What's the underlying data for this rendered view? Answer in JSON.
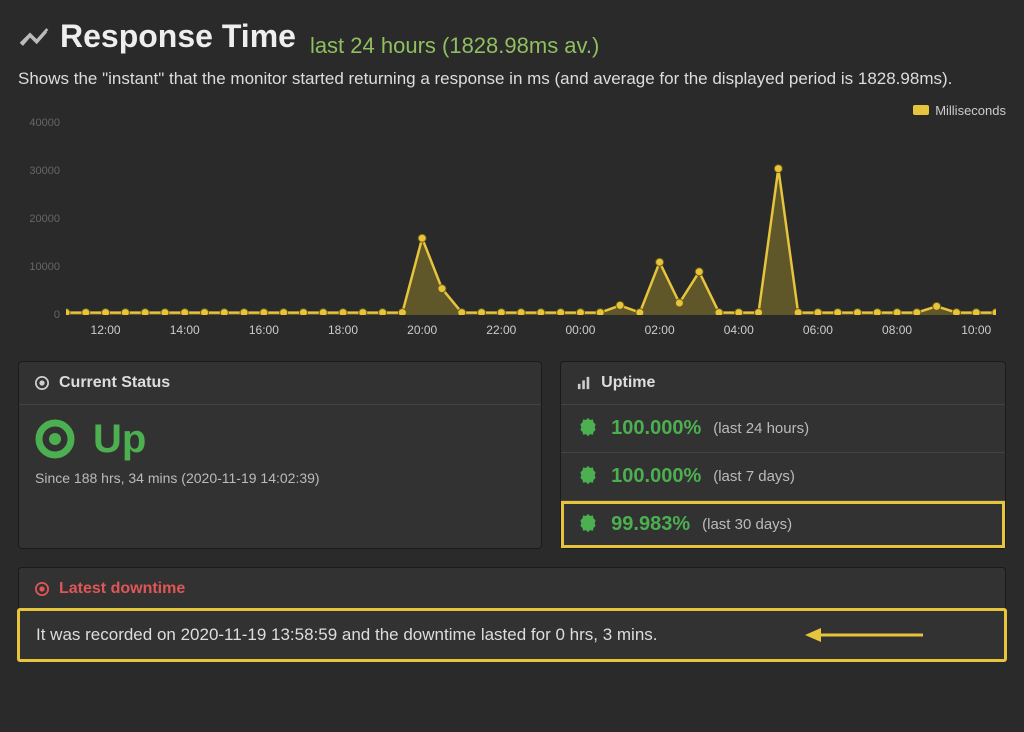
{
  "header": {
    "title": "Response Time",
    "subtitle": "last 24 hours  (1828.98ms av.)",
    "description": "Shows the \"instant\" that the monitor started returning a response in ms (and average for the displayed period is 1828.98ms)."
  },
  "legend_label": "Milliseconds",
  "current_status": {
    "header": "Current Status",
    "status": "Up",
    "since": "Since 188 hrs, 34 mins (2020-11-19 14:02:39)"
  },
  "uptime": {
    "header": "Uptime",
    "rows": [
      {
        "pct": "100.000%",
        "period": "(last 24 hours)",
        "highlight": false
      },
      {
        "pct": "100.000%",
        "period": "(last 7 days)",
        "highlight": false
      },
      {
        "pct": "99.983%",
        "period": "(last 30 days)",
        "highlight": true
      }
    ]
  },
  "downtime": {
    "header": "Latest downtime",
    "text": "It was recorded on 2020-11-19 13:58:59 and the downtime lasted for 0 hrs, 3 mins."
  },
  "chart_data": {
    "type": "line",
    "title": "Response Time",
    "xlabel": "",
    "ylabel": "",
    "ylim": [
      0,
      40000
    ],
    "x": [
      "11:00",
      "11:30",
      "12:00",
      "12:30",
      "13:00",
      "13:30",
      "14:00",
      "14:30",
      "15:00",
      "15:30",
      "16:00",
      "16:30",
      "17:00",
      "17:30",
      "18:00",
      "18:30",
      "19:00",
      "19:30",
      "20:00",
      "20:30",
      "21:00",
      "21:30",
      "22:00",
      "22:30",
      "23:00",
      "23:30",
      "00:00",
      "00:30",
      "01:00",
      "01:30",
      "02:00",
      "02:30",
      "03:00",
      "03:30",
      "04:00",
      "04:30",
      "05:00",
      "05:30",
      "06:00",
      "06:30",
      "07:00",
      "07:30",
      "08:00",
      "08:30",
      "09:00",
      "09:30",
      "10:00",
      "10:30"
    ],
    "series": [
      {
        "name": "Milliseconds",
        "values": [
          500,
          500,
          500,
          500,
          500,
          500,
          500,
          500,
          500,
          500,
          500,
          500,
          500,
          500,
          500,
          500,
          500,
          500,
          16000,
          5500,
          500,
          500,
          500,
          500,
          500,
          500,
          500,
          500,
          2000,
          500,
          11000,
          2500,
          9000,
          500,
          500,
          500,
          30500,
          500,
          500,
          500,
          500,
          500,
          500,
          500,
          1800,
          500,
          500,
          500
        ]
      }
    ],
    "y_ticks": [
      0,
      10000,
      20000,
      30000,
      40000
    ],
    "x_ticks_shown": [
      "12:00",
      "14:00",
      "16:00",
      "18:00",
      "20:00",
      "22:00",
      "00:00",
      "02:00",
      "04:00",
      "06:00",
      "08:00",
      "10:00"
    ],
    "legend": "Milliseconds",
    "colors": {
      "line": "#e6c43c",
      "fill": "#8a7a28"
    }
  }
}
